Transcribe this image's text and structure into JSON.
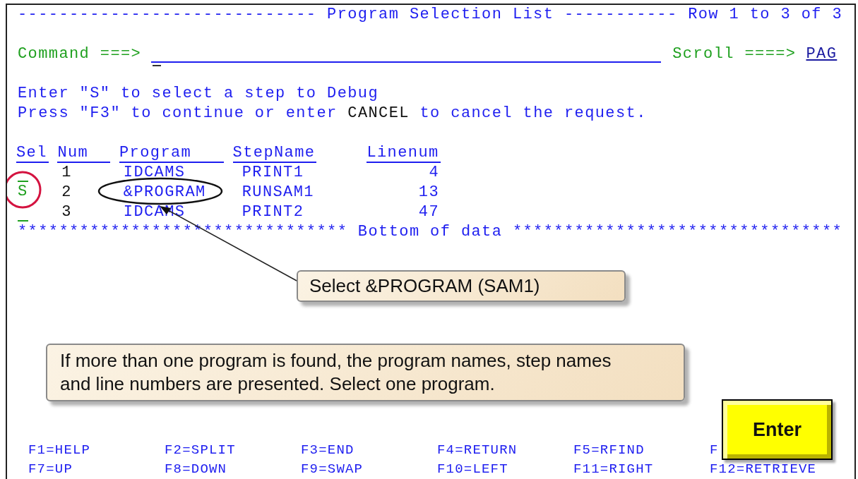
{
  "title_line": "----------------------------- Program Selection List ----------- Row 1 to 3 of 3",
  "command": {
    "label": "Command ===>",
    "scroll_label": "Scroll ====>",
    "scroll_value": "PAG"
  },
  "instructions": [
    [
      {
        "kind": "text",
        "text": "Enter \"S\" to select a step to Debug"
      }
    ],
    [
      {
        "kind": "text",
        "text": "Press \"F3\" to continue or enter "
      },
      {
        "kind": "keyword",
        "text": "CANCEL"
      },
      {
        "kind": "text",
        "text": " to cancel the request."
      }
    ]
  ],
  "columns": [
    "Sel",
    "Num",
    "Program",
    "StepName",
    "Linenum"
  ],
  "rows": [
    {
      "sel": "",
      "num": "1",
      "program": "IDCAMS",
      "step": "PRINT1",
      "line": "4",
      "circled": false
    },
    {
      "sel": "S",
      "num": "2",
      "program": "&PROGRAM",
      "step": "RUNSAM1",
      "line": "13",
      "circled": true
    },
    {
      "sel": "",
      "num": "3",
      "program": "IDCAMS",
      "step": "PRINT2",
      "line": "47",
      "circled": false
    }
  ],
  "bottom_line": "******************************** Bottom of data ********************************",
  "callouts": [
    {
      "kind": "pointer",
      "text": "Select &PROGRAM (SAM1)"
    },
    {
      "kind": "note",
      "text": "If more than one program is found, the program names, step names and line numbers are presented. Select one program."
    }
  ],
  "enter_key": "Enter",
  "function_keys": [
    [
      "F1=HELP",
      "F2=SPLIT",
      "F3=END",
      "F4=RETURN",
      "F5=RFIND",
      "F"
    ],
    [
      "F7=UP",
      "F8=DOWN",
      "F9=SWAP",
      "F10=LEFT",
      "F11=RIGHT",
      "F12=RETRIEVE"
    ]
  ]
}
